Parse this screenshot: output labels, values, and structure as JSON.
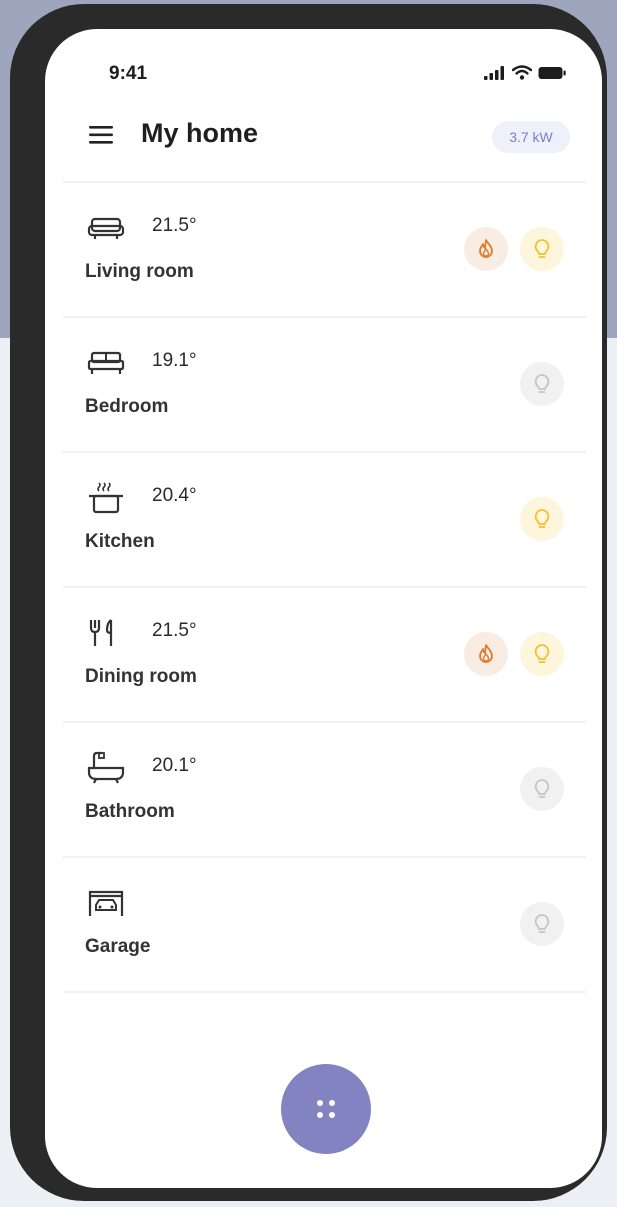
{
  "status_bar": {
    "time": "9:41"
  },
  "header": {
    "title": "My home",
    "power": "3.7 kW"
  },
  "rooms": [
    {
      "name": "Living room",
      "temperature": "21.5°",
      "icon": "sofa-icon",
      "heating": true,
      "light": "on"
    },
    {
      "name": "Bedroom",
      "temperature": "19.1°",
      "icon": "bed-icon",
      "heating": false,
      "light": "off"
    },
    {
      "name": "Kitchen",
      "temperature": "20.4°",
      "icon": "cooking-pot-icon",
      "heating": false,
      "light": "on"
    },
    {
      "name": "Dining room",
      "temperature": "21.5°",
      "icon": "cutlery-icon",
      "heating": true,
      "light": "on"
    },
    {
      "name": "Bathroom",
      "temperature": "20.1°",
      "icon": "bathtub-icon",
      "heating": false,
      "light": "off"
    },
    {
      "name": "Garage",
      "temperature": "",
      "icon": "garage-car-icon",
      "heating": false,
      "light": "off"
    }
  ],
  "fab": {
    "icon": "four-dots-grid-icon"
  },
  "colors": {
    "accent": "#8283c0",
    "heat_icon": "#e07a2c",
    "light_on": "#f2c22a",
    "light_off": "#c4c4c4",
    "badge_text": "#7a80c4"
  }
}
